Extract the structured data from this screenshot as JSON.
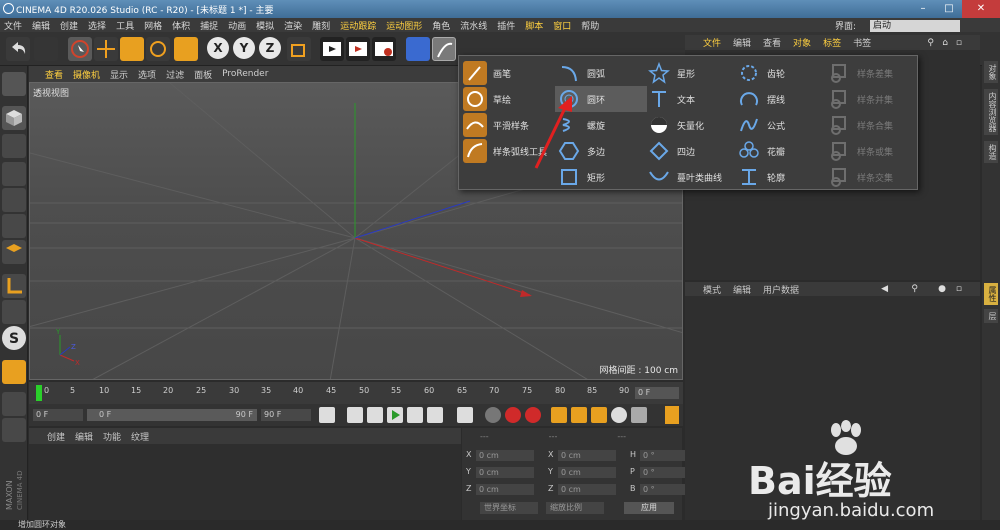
{
  "window": {
    "title": "CINEMA 4D R20.026 Studio (RC - R20) - [未标题 1 *] - 主要"
  },
  "menubar": {
    "items": [
      "文件",
      "编辑",
      "创建",
      "选择",
      "工具",
      "网格",
      "体积",
      "捕捉",
      "动画",
      "模拟",
      "渲染",
      "雕刻",
      "运动跟踪",
      "运动图形",
      "角色",
      "流水线",
      "插件",
      "脚本",
      "窗口",
      "帮助"
    ],
    "layout_label": "界面:",
    "layout_value": "启动"
  },
  "viewport": {
    "menu": [
      "查看",
      "摄像机",
      "显示",
      "选项",
      "过滤",
      "面板",
      "ProRender"
    ],
    "label": "透视视图",
    "grid_text": "网格间距 : 100 cm"
  },
  "timeline": {
    "ticks": [
      "0",
      "5",
      "10",
      "15",
      "20",
      "25",
      "30",
      "35",
      "40",
      "45",
      "50",
      "55",
      "60",
      "65",
      "70",
      "75",
      "80",
      "85",
      "90"
    ],
    "frame_field": "0 F"
  },
  "transport": {
    "start": "0 F",
    "range_start": "0 F",
    "range_end": "90 F",
    "end": "90 F"
  },
  "material_panel": {
    "menu": [
      "创建",
      "编辑",
      "功能",
      "纹理"
    ]
  },
  "coords": {
    "headers": [
      "---",
      "---",
      "---"
    ],
    "rows": [
      {
        "a": "X",
        "av": "0 cm",
        "b": "X",
        "bv": "0 cm",
        "c": "H",
        "cv": "0 °"
      },
      {
        "a": "Y",
        "av": "0 cm",
        "b": "Y",
        "bv": "0 cm",
        "c": "P",
        "cv": "0 °"
      },
      {
        "a": "Z",
        "av": "0 cm",
        "b": "Z",
        "bv": "0 cm",
        "c": "B",
        "cv": "0 °"
      }
    ],
    "mode1": "世界坐标",
    "mode2": "缩放比例",
    "apply": "应用"
  },
  "object_panel": {
    "menu": [
      "文件",
      "编辑",
      "查看",
      "对象",
      "标签",
      "书签"
    ]
  },
  "attr_panel": {
    "menu": [
      "模式",
      "编辑",
      "用户数据"
    ]
  },
  "right_tabs": [
    "对象",
    "内容浏览器",
    "构造",
    "属性",
    "层"
  ],
  "status": "增加圆环对象",
  "popup": {
    "col1": [
      "画笔",
      "草绘",
      "平滑样条",
      "样条弧线工具"
    ],
    "col2": [
      "圆弧",
      "圆环",
      "螺旋",
      "多边",
      "矩形"
    ],
    "col3": [
      "星形",
      "文本",
      "矢量化",
      "四边",
      "蔓叶类曲线"
    ],
    "col4": [
      "齿轮",
      "摆线",
      "公式",
      "花瓣",
      "轮廓"
    ],
    "col5": [
      "样条差集",
      "样条并集",
      "样条合集",
      "样条或集",
      "样条交集"
    ],
    "selected": "圆环"
  },
  "watermark": {
    "brand": "Bai经验",
    "url": "jingyan.baidu.com"
  },
  "brand": "MAXON CINEMA 4D"
}
